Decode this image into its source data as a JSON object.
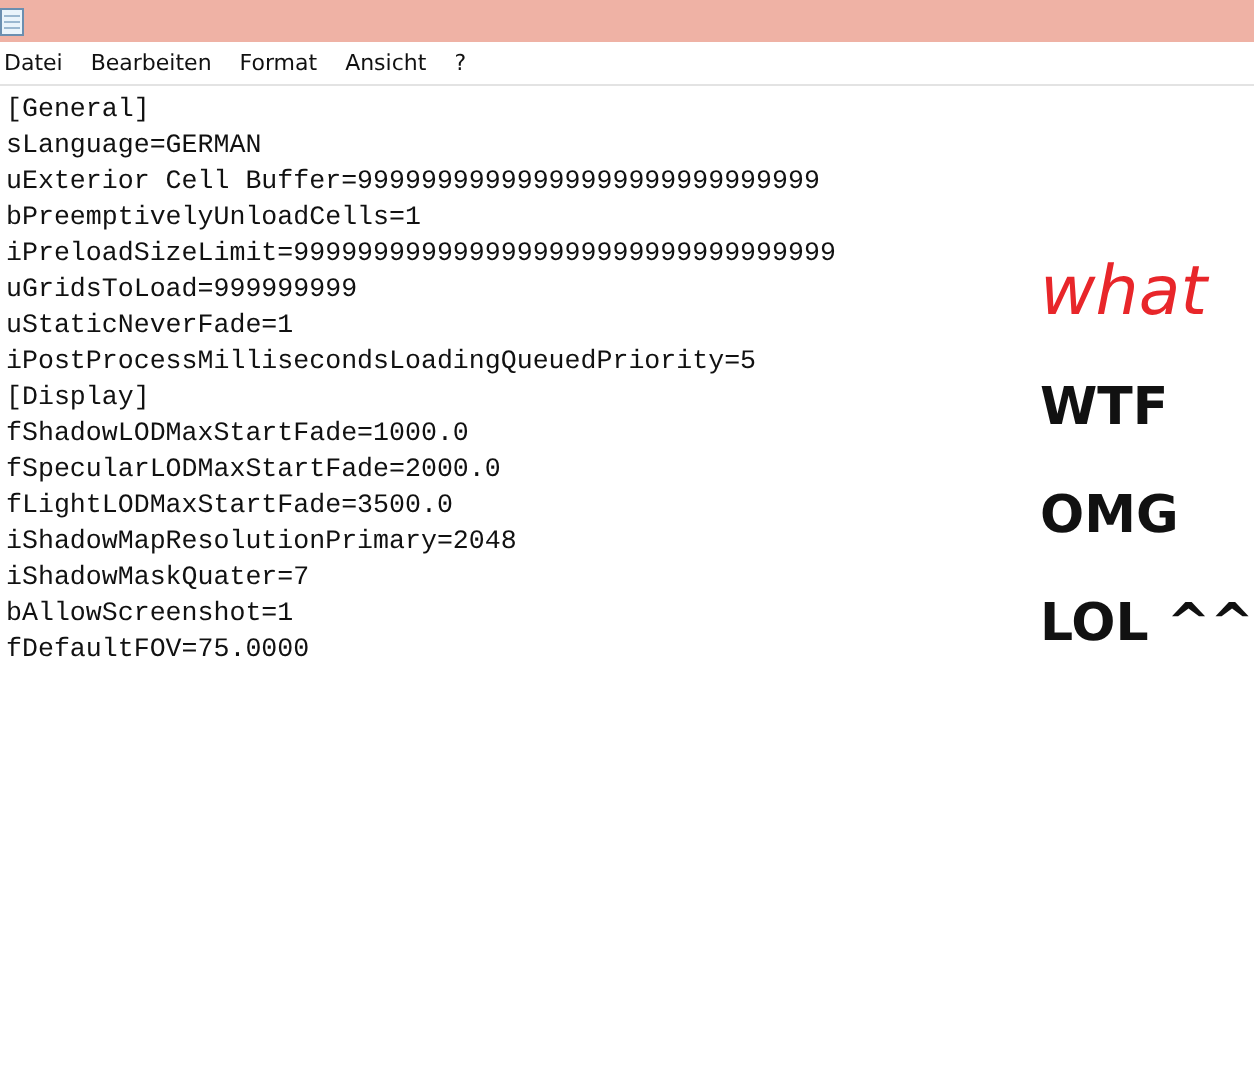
{
  "menu": [
    "Datei",
    "Bearbeiten",
    "Format",
    "Ansicht",
    "?"
  ],
  "lines": [
    "[General]",
    "sLanguage=GERMAN",
    "uExterior Cell Buffer=99999999999999999999999999999",
    "bPreemptivelyUnloadCells=1",
    "iPreloadSizeLimit=9999999999999999999999999999999999",
    "uGridsToLoad=999999999",
    "uStaticNeverFade=1",
    "iPostProcessMillisecondsLoadingQueuedPriority=5",
    "[Display]",
    "fShadowLODMaxStartFade=1000.0",
    "fSpecularLODMaxStartFade=2000.0",
    "fLightLODMaxStartFade=3500.0",
    "iShadowMapResolutionPrimary=2048",
    "iShadowMaskQuater=7",
    "bAllowScreenshot=1",
    "fDefaultFOV=75.0000"
  ],
  "stickers": [
    {
      "text": "what",
      "color": "#e8262a"
    },
    {
      "text": "WTF",
      "color": "#111111"
    },
    {
      "text": "OMG",
      "color": "#111111"
    },
    {
      "text": "LOL ^^",
      "color": "#111111"
    }
  ]
}
